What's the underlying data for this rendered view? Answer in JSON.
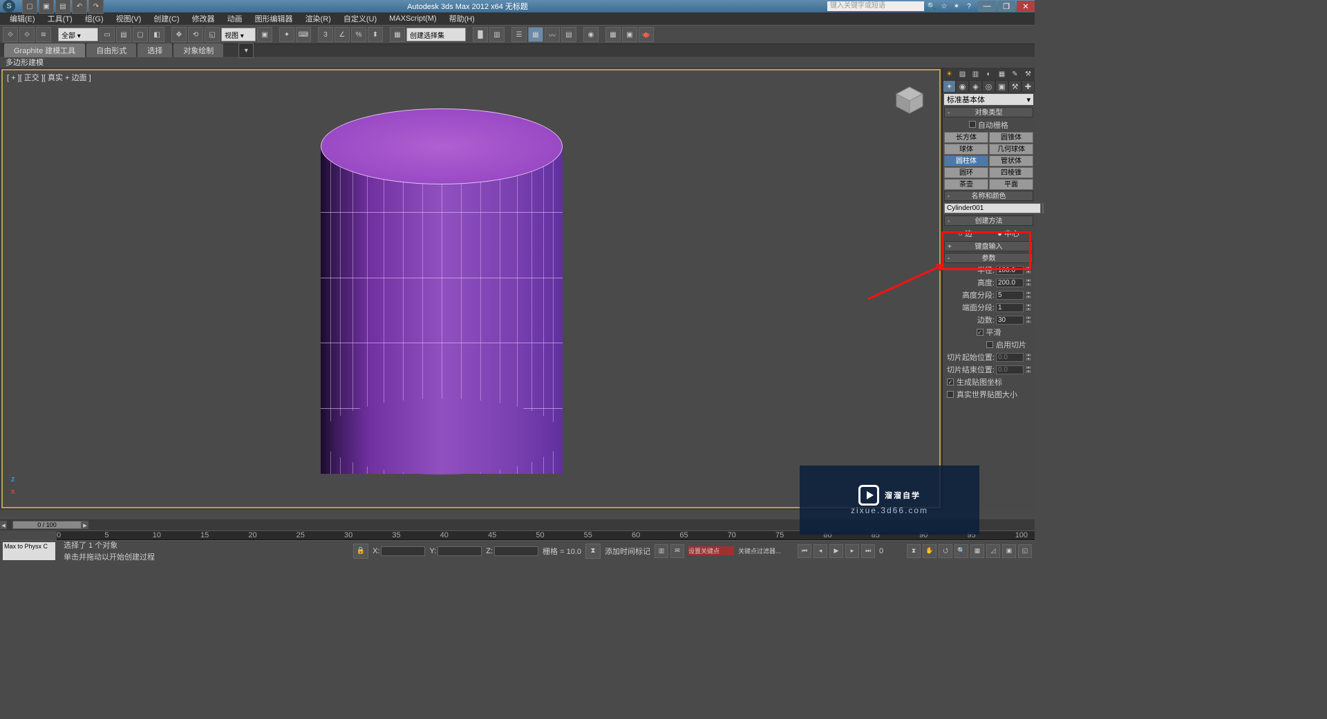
{
  "title": "Autodesk 3ds Max  2012 x64     无标题",
  "search_placeholder": "键入关键字或短语",
  "menu": [
    "编辑(E)",
    "工具(T)",
    "组(G)",
    "视图(V)",
    "创建(C)",
    "修改器",
    "动画",
    "图形编辑器",
    "渲染(R)",
    "自定义(U)",
    "MAXScript(M)",
    "帮助(H)"
  ],
  "toolbar": {
    "scope_drop": "全部 ▾",
    "view_drop": "视图 ▾",
    "select_set": "创建选择集"
  },
  "ribbon": {
    "tabs": [
      "Graphite 建模工具",
      "自由形式",
      "选择",
      "对象绘制"
    ],
    "sub": "多边形建模"
  },
  "viewport": {
    "label": "[ + ][ 正交 ][ 真实 + 边面 ]"
  },
  "cmd": {
    "primitive_drop": "标准基本体",
    "rollout_objtype": "对象类型",
    "auto_grid": "自动栅格",
    "objects": [
      "长方体",
      "圆锥体",
      "球体",
      "几何球体",
      "圆柱体",
      "管状体",
      "圆环",
      "四棱锥",
      "茶壶",
      "平面"
    ],
    "rollout_namecolor": "名称和颜色",
    "obj_name": "Cylinder001",
    "rollout_createmethod": "创建方法",
    "radio_edge": "边",
    "radio_center": "中心",
    "rollout_keyboard": "键盘输入",
    "rollout_params": "参数",
    "params": {
      "radius_lbl": "半径:",
      "radius_val": "100.0",
      "height_lbl": "高度:",
      "height_val": "200.0",
      "hseg_lbl": "高度分段:",
      "hseg_val": "5",
      "cseg_lbl": "端面分段:",
      "cseg_val": "1",
      "sides_lbl": "边数:",
      "sides_val": "30",
      "smooth": "平滑",
      "slice_on": "启用切片",
      "slice_from_lbl": "切片起始位置:",
      "slice_from_val": "0.0",
      "slice_to_lbl": "切片结束位置:",
      "slice_to_val": "0.0",
      "gen_uv": "生成贴图坐标",
      "real_uv": "真实世界贴图大小"
    }
  },
  "time": {
    "slider": "0 / 100",
    "ticks": [
      0,
      5,
      10,
      15,
      20,
      25,
      30,
      35,
      40,
      45,
      50,
      55,
      60,
      65,
      70,
      75,
      80,
      85,
      90,
      95,
      100
    ]
  },
  "status": {
    "left_box": "Max to Physx C",
    "msg1": "选择了 1 个对象",
    "msg2": "单击并拖动以开始创建过程",
    "x": "X:",
    "y": "Y:",
    "z": "Z:",
    "grid_lbl": "栅格 = 10.0",
    "add_time": "添加时间标记",
    "set_key": "设置关键点",
    "key_filter": "关键点过滤器..."
  },
  "watermark": {
    "big": "溜溜自学",
    "small": "zixue.3d66.com"
  }
}
